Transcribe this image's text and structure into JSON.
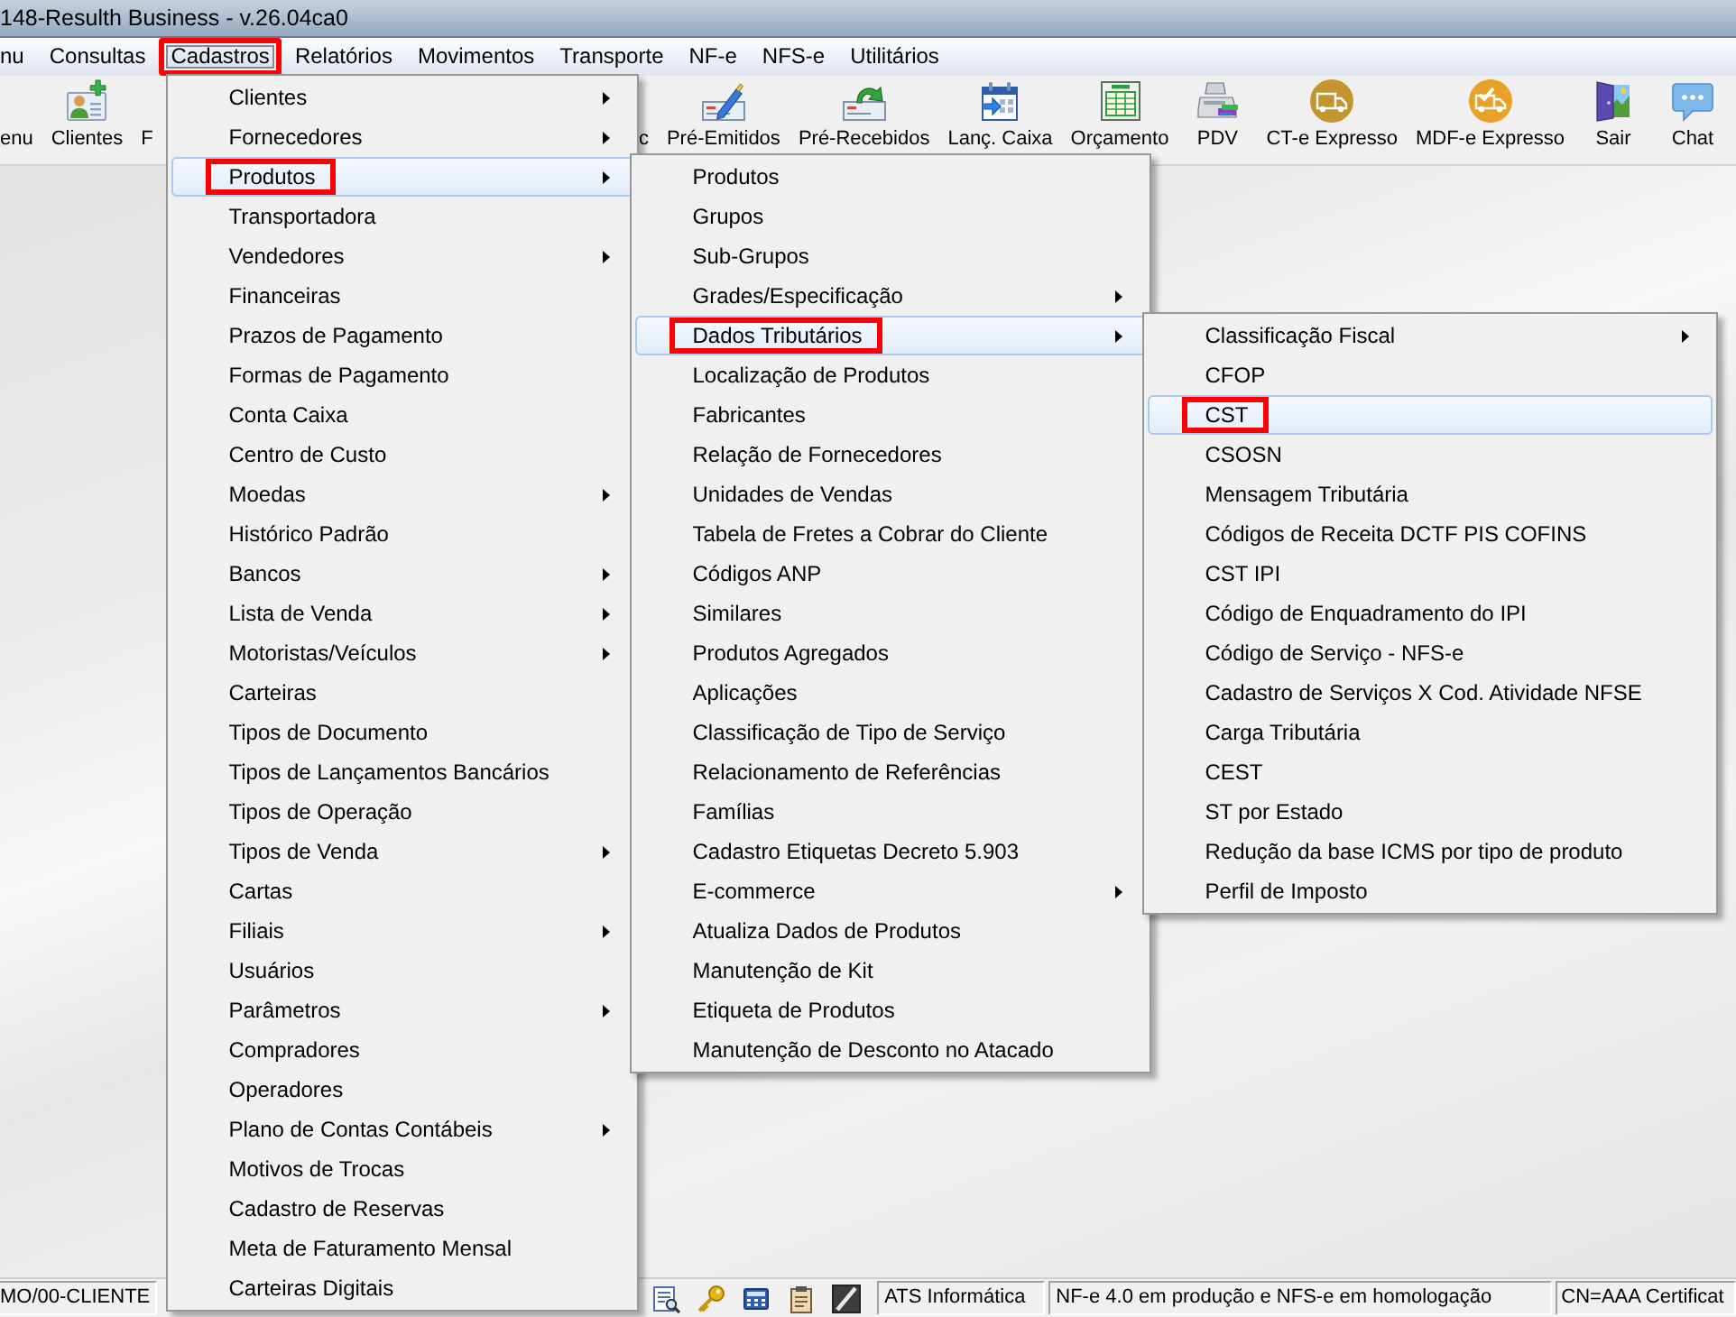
{
  "window": {
    "title": "148-Resulth Business - v.26.04ca0"
  },
  "menu_bar": {
    "items": [
      {
        "label": "nu",
        "selected": false,
        "annotated": false
      },
      {
        "label": "Consultas",
        "selected": false,
        "annotated": false
      },
      {
        "label": "Cadastros",
        "selected": true,
        "annotated": true,
        "children": [
          {
            "label": "Clientes",
            "submenu": true,
            "selected": false,
            "annotated": false
          },
          {
            "label": "Fornecedores",
            "submenu": true,
            "selected": false,
            "annotated": false
          },
          {
            "label": "Produtos",
            "submenu": true,
            "selected": true,
            "annotated": true,
            "children": [
              {
                "label": "Produtos",
                "submenu": false,
                "selected": false,
                "annotated": false
              },
              {
                "label": "Grupos",
                "submenu": false,
                "selected": false,
                "annotated": false
              },
              {
                "label": "Sub-Grupos",
                "submenu": false,
                "selected": false,
                "annotated": false
              },
              {
                "label": "Grades/Especificação",
                "submenu": true,
                "selected": false,
                "annotated": false
              },
              {
                "label": "Dados Tributários",
                "submenu": true,
                "selected": true,
                "annotated": true,
                "children": [
                  {
                    "label": "Classificação Fiscal",
                    "submenu": true,
                    "selected": false,
                    "annotated": false
                  },
                  {
                    "label": "CFOP",
                    "submenu": false,
                    "selected": false,
                    "annotated": false
                  },
                  {
                    "label": "CST",
                    "submenu": false,
                    "selected": true,
                    "annotated": true
                  },
                  {
                    "label": "CSOSN",
                    "submenu": false,
                    "selected": false,
                    "annotated": false
                  },
                  {
                    "label": "Mensagem Tributária",
                    "submenu": false,
                    "selected": false,
                    "annotated": false
                  },
                  {
                    "label": "Códigos de Receita DCTF PIS COFINS",
                    "submenu": false,
                    "selected": false,
                    "annotated": false
                  },
                  {
                    "label": "CST IPI",
                    "submenu": false,
                    "selected": false,
                    "annotated": false
                  },
                  {
                    "label": "Código de Enquadramento do IPI",
                    "submenu": false,
                    "selected": false,
                    "annotated": false
                  },
                  {
                    "label": "Código de Serviço - NFS-e",
                    "submenu": false,
                    "selected": false,
                    "annotated": false
                  },
                  {
                    "label": "Cadastro de Serviços X Cod. Atividade NFSE",
                    "submenu": false,
                    "selected": false,
                    "annotated": false
                  },
                  {
                    "label": "Carga Tributária",
                    "submenu": false,
                    "selected": false,
                    "annotated": false
                  },
                  {
                    "label": "CEST",
                    "submenu": false,
                    "selected": false,
                    "annotated": false
                  },
                  {
                    "label": "ST por Estado",
                    "submenu": false,
                    "selected": false,
                    "annotated": false
                  },
                  {
                    "label": "Redução da base ICMS por tipo de produto",
                    "submenu": false,
                    "selected": false,
                    "annotated": false
                  },
                  {
                    "label": "Perfil de Imposto",
                    "submenu": false,
                    "selected": false,
                    "annotated": false
                  }
                ]
              },
              {
                "label": "Localização de Produtos",
                "submenu": false,
                "selected": false,
                "annotated": false
              },
              {
                "label": "Fabricantes",
                "submenu": false,
                "selected": false,
                "annotated": false
              },
              {
                "label": "Relação de Fornecedores",
                "submenu": false,
                "selected": false,
                "annotated": false
              },
              {
                "label": "Unidades de Vendas",
                "submenu": false,
                "selected": false,
                "annotated": false
              },
              {
                "label": "Tabela de Fretes a Cobrar do Cliente",
                "submenu": false,
                "selected": false,
                "annotated": false
              },
              {
                "label": "Códigos ANP",
                "submenu": false,
                "selected": false,
                "annotated": false
              },
              {
                "label": "Similares",
                "submenu": false,
                "selected": false,
                "annotated": false
              },
              {
                "label": "Produtos Agregados",
                "submenu": false,
                "selected": false,
                "annotated": false
              },
              {
                "label": "Aplicações",
                "submenu": false,
                "selected": false,
                "annotated": false
              },
              {
                "label": "Classificação de Tipo de Serviço",
                "submenu": false,
                "selected": false,
                "annotated": false
              },
              {
                "label": "Relacionamento de Referências",
                "submenu": false,
                "selected": false,
                "annotated": false
              },
              {
                "label": "Famílias",
                "submenu": false,
                "selected": false,
                "annotated": false
              },
              {
                "label": "Cadastro Etiquetas Decreto 5.903",
                "submenu": false,
                "selected": false,
                "annotated": false
              },
              {
                "label": "E-commerce",
                "submenu": true,
                "selected": false,
                "annotated": false
              },
              {
                "label": "Atualiza Dados de Produtos",
                "submenu": false,
                "selected": false,
                "annotated": false
              },
              {
                "label": "Manutenção de Kit",
                "submenu": false,
                "selected": false,
                "annotated": false
              },
              {
                "label": "Etiqueta de Produtos",
                "submenu": false,
                "selected": false,
                "annotated": false
              },
              {
                "label": "Manutenção de Desconto no Atacado",
                "submenu": false,
                "selected": false,
                "annotated": false
              }
            ]
          },
          {
            "label": "Transportadora",
            "submenu": false,
            "selected": false,
            "annotated": false
          },
          {
            "label": "Vendedores",
            "submenu": true,
            "selected": false,
            "annotated": false
          },
          {
            "label": "Financeiras",
            "submenu": false,
            "selected": false,
            "annotated": false
          },
          {
            "label": "Prazos de Pagamento",
            "submenu": false,
            "selected": false,
            "annotated": false
          },
          {
            "label": "Formas de Pagamento",
            "submenu": false,
            "selected": false,
            "annotated": false
          },
          {
            "label": "Conta Caixa",
            "submenu": false,
            "selected": false,
            "annotated": false
          },
          {
            "label": "Centro de Custo",
            "submenu": false,
            "selected": false,
            "annotated": false
          },
          {
            "label": "Moedas",
            "submenu": true,
            "selected": false,
            "annotated": false
          },
          {
            "label": "Histórico Padrão",
            "submenu": false,
            "selected": false,
            "annotated": false
          },
          {
            "label": "Bancos",
            "submenu": true,
            "selected": false,
            "annotated": false
          },
          {
            "label": "Lista de Venda",
            "submenu": true,
            "selected": false,
            "annotated": false
          },
          {
            "label": "Motoristas/Veículos",
            "submenu": true,
            "selected": false,
            "annotated": false
          },
          {
            "label": "Carteiras",
            "submenu": false,
            "selected": false,
            "annotated": false
          },
          {
            "label": "Tipos de Documento",
            "submenu": false,
            "selected": false,
            "annotated": false
          },
          {
            "label": "Tipos de Lançamentos Bancários",
            "submenu": false,
            "selected": false,
            "annotated": false
          },
          {
            "label": "Tipos de Operação",
            "submenu": false,
            "selected": false,
            "annotated": false
          },
          {
            "label": "Tipos de Venda",
            "submenu": true,
            "selected": false,
            "annotated": false
          },
          {
            "label": "Cartas",
            "submenu": false,
            "selected": false,
            "annotated": false
          },
          {
            "label": "Filiais",
            "submenu": true,
            "selected": false,
            "annotated": false
          },
          {
            "label": "Usuários",
            "submenu": false,
            "selected": false,
            "annotated": false
          },
          {
            "label": "Parâmetros",
            "submenu": true,
            "selected": false,
            "annotated": false
          },
          {
            "label": "Compradores",
            "submenu": false,
            "selected": false,
            "annotated": false
          },
          {
            "label": "Operadores",
            "submenu": false,
            "selected": false,
            "annotated": false
          },
          {
            "label": "Plano de Contas Contábeis",
            "submenu": true,
            "selected": false,
            "annotated": false
          },
          {
            "label": "Motivos de Trocas",
            "submenu": false,
            "selected": false,
            "annotated": false
          },
          {
            "label": "Cadastro de Reservas",
            "submenu": false,
            "selected": false,
            "annotated": false
          },
          {
            "label": "Meta de Faturamento Mensal",
            "submenu": false,
            "selected": false,
            "annotated": false
          },
          {
            "label": "Carteiras Digitais",
            "submenu": false,
            "selected": false,
            "annotated": false
          }
        ]
      },
      {
        "label": "Relatórios",
        "selected": false,
        "annotated": false
      },
      {
        "label": "Movimentos",
        "selected": false,
        "annotated": false
      },
      {
        "label": "Transporte",
        "selected": false,
        "annotated": false
      },
      {
        "label": "NF-e",
        "selected": false,
        "annotated": false
      },
      {
        "label": "NFS-e",
        "selected": false,
        "annotated": false
      },
      {
        "label": "Utilitários",
        "selected": false,
        "annotated": false
      }
    ]
  },
  "toolbar": {
    "buttons": [
      {
        "label": "enu"
      },
      {
        "label": "Clientes"
      },
      {
        "label": "F"
      },
      {
        "label": "c"
      },
      {
        "label": "Pré-Emitidos"
      },
      {
        "label": "Pré-Recebidos"
      },
      {
        "label": "Lanç. Caixa"
      },
      {
        "label": "Orçamento"
      },
      {
        "label": "PDV"
      },
      {
        "label": "CT-e Expresso"
      },
      {
        "label": "MDF-e Expresso"
      },
      {
        "label": "Sair"
      },
      {
        "label": "Chat"
      }
    ]
  },
  "status_bar": {
    "panels": [
      "MO/00-CLIENTE",
      "ATS Informática",
      "NF-e 4.0 em produção e NFS-e em homologação",
      "CN=AAA Certificat"
    ]
  }
}
